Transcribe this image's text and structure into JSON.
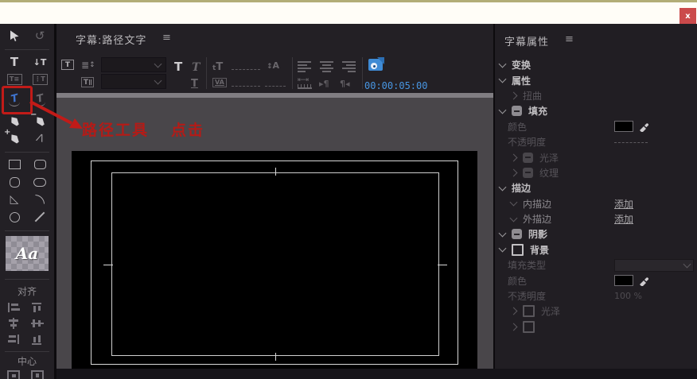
{
  "window": {
    "close_label": "x"
  },
  "titlebar": {
    "title": "字幕:路径文字",
    "menu_icon": "≡"
  },
  "toolbar": {
    "show_video_glyph": "T",
    "roll_crawl_glyph": "≣",
    "roll_crawl_arrow": "↕",
    "tab_stops_glyph": "T",
    "font_family_value": "",
    "font_style_value": "",
    "bold_glyph": "T",
    "italic_glyph": "T",
    "underline_glyph": "T",
    "font_size_small": "t",
    "font_size_big": "T",
    "leading_glyph": "A",
    "leading_arrow": "↕",
    "kerning_glyph": "VA",
    "ruler_arrows": "⇤⇥",
    "para_indent_glyph": "▸¶",
    "para_outdent_glyph": "¶◂",
    "timecode": "00:00:05:00"
  },
  "annotation": {
    "label_tool": "路径工具",
    "label_click": "点击"
  },
  "tools": {
    "rotation_glyph": "↺",
    "type_glyph": "T",
    "vertical_type_glyph": "↓T",
    "area_type_glyph": "T≡",
    "vertical_area_type_glyph": "⋮T",
    "path_type_glyph": "T",
    "vertical_path_type_glyph": "T",
    "delete_anchor_mod": "−",
    "add_anchor_mod": "+",
    "convert_anchor_glyph": "Λ",
    "wedge_glyph": "◺",
    "font_sample": "Aa"
  },
  "align_panel": {
    "align_label": "对齐",
    "center_label": "中心"
  },
  "right_panel": {
    "header": "字幕属性",
    "menu_icon": "≡",
    "rows": [
      {
        "label": "变换"
      },
      {
        "label": "属性"
      },
      {
        "label": "扭曲"
      },
      {
        "label": "填充"
      },
      {
        "label": "颜色"
      },
      {
        "label": "不透明度",
        "value": ""
      },
      {
        "label": "光泽"
      },
      {
        "label": "纹理"
      },
      {
        "label": "描边"
      },
      {
        "label": "内描边",
        "value": "添加"
      },
      {
        "label": "外描边",
        "value": "添加"
      },
      {
        "label": "阴影"
      },
      {
        "label": "背景"
      },
      {
        "label": "填充类型"
      },
      {
        "label": "颜色"
      },
      {
        "label": "不透明度",
        "value": "100 %"
      },
      {
        "label": "光泽"
      },
      {
        "label": ""
      }
    ]
  },
  "colors": {
    "accent_blue": "#3f8bd5",
    "timecode_blue": "#4896e2",
    "annotation_red": "#c11b18",
    "swatch_black": "#000000",
    "top_strip": "#fffdf7"
  }
}
